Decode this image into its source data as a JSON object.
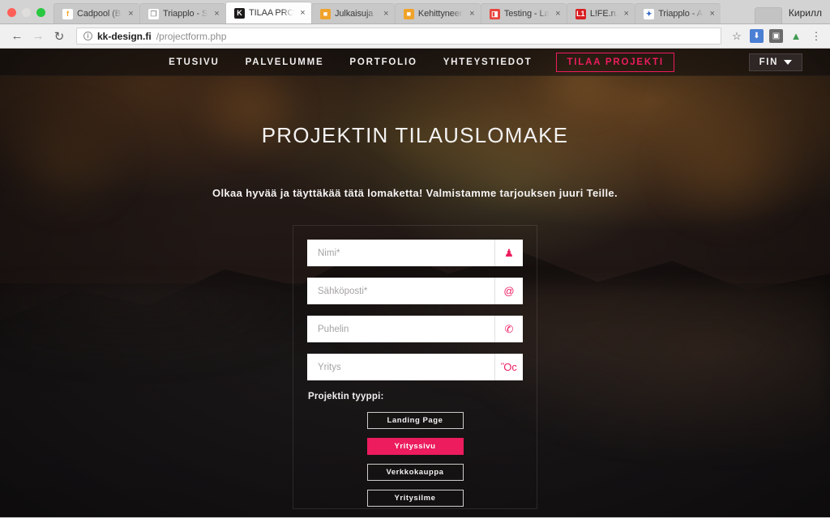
{
  "browser": {
    "profile_name": "Кирилл",
    "tabs": [
      {
        "title": "Cadpool (Ba G",
        "favicon_letter": "f",
        "favicon_color": "#f5a623",
        "favicon_bg": "#ffffff",
        "active": false,
        "close_label": "×"
      },
      {
        "title": "Triapplo - Syst",
        "favicon_letter": "❐",
        "favicon_color": "#9a9a9a",
        "favicon_bg": "#ffffff",
        "active": false,
        "close_label": "×"
      },
      {
        "title": "TILAA PROJEK",
        "favicon_letter": "K",
        "favicon_color": "#ffffff",
        "favicon_bg": "#1c1a18",
        "active": true,
        "close_label": "×"
      },
      {
        "title": "Julkaisuja -",
        "favicon_letter": "■",
        "favicon_color": "#ffffff",
        "favicon_bg": "#f0a32a",
        "active": false,
        "close_label": "×"
      },
      {
        "title": "Kehittyneempi",
        "favicon_letter": "■",
        "favicon_color": "#ffffff",
        "favicon_bg": "#f0a32a",
        "active": false,
        "close_label": "×"
      },
      {
        "title": "Testing - Lara",
        "favicon_letter": "◨",
        "favicon_color": "#ffffff",
        "favicon_bg": "#e8453c",
        "active": false,
        "close_label": "×"
      },
      {
        "title": "L!FE.ru",
        "favicon_letter": "L1",
        "favicon_color": "#ffffff",
        "favicon_bg": "#d81e21",
        "active": false,
        "close_label": "×"
      },
      {
        "title": "Triapplo - Agil",
        "favicon_letter": "✦",
        "favicon_color": "#2f64c8",
        "favicon_bg": "#ffffff",
        "active": false,
        "close_label": "×"
      }
    ],
    "toolbar": {
      "back_label": "←",
      "forward_label": "→",
      "reload_label": "↻",
      "info_label": "i",
      "url_host": "kk-design.fi",
      "url_path": "/projectform.php",
      "bookmark_label": "☆",
      "download_label": "⬇",
      "extension_label": "▣",
      "profile_glyph": "▲",
      "menu_label": "⋮"
    }
  },
  "site": {
    "nav_items": [
      {
        "label": "ETUSIVU"
      },
      {
        "label": "PALVELUMME"
      },
      {
        "label": "PORTFOLIO"
      },
      {
        "label": "YHTEYSTIEDOT"
      }
    ],
    "nav_cta": "TILAA PROJEKTI",
    "language": "FIN"
  },
  "hero": {
    "title": "PROJEKTIN TILAUSLOMAKE",
    "subtitle": "Olkaa hyvää ja täyttäkää tätä lomaketta! Valmistamme tarjouksen juuri Teille."
  },
  "form": {
    "fields": [
      {
        "placeholder": "Nimi*",
        "icon": "user-icon",
        "glyph": "♟"
      },
      {
        "placeholder": "Sähköposti*",
        "icon": "at-email-icon",
        "glyph": "@"
      },
      {
        "placeholder": "Puhelin",
        "icon": "phone-icon",
        "glyph": "✆"
      },
      {
        "placeholder": "Yritys",
        "icon": "briefcase-icon",
        "glyph": "Ὃc"
      }
    ],
    "type_label": "Projektin tyyppi:",
    "type_options": [
      {
        "label": "Landing Page",
        "selected": false
      },
      {
        "label": "Yrityssivu",
        "selected": true
      },
      {
        "label": "Verkkokauppa",
        "selected": false
      },
      {
        "label": "Yritysilme",
        "selected": false
      }
    ]
  },
  "colors": {
    "accent_pink": "#ec1c5e",
    "hero_text": "#f3f1f1",
    "field_bg": "#ffffff"
  }
}
